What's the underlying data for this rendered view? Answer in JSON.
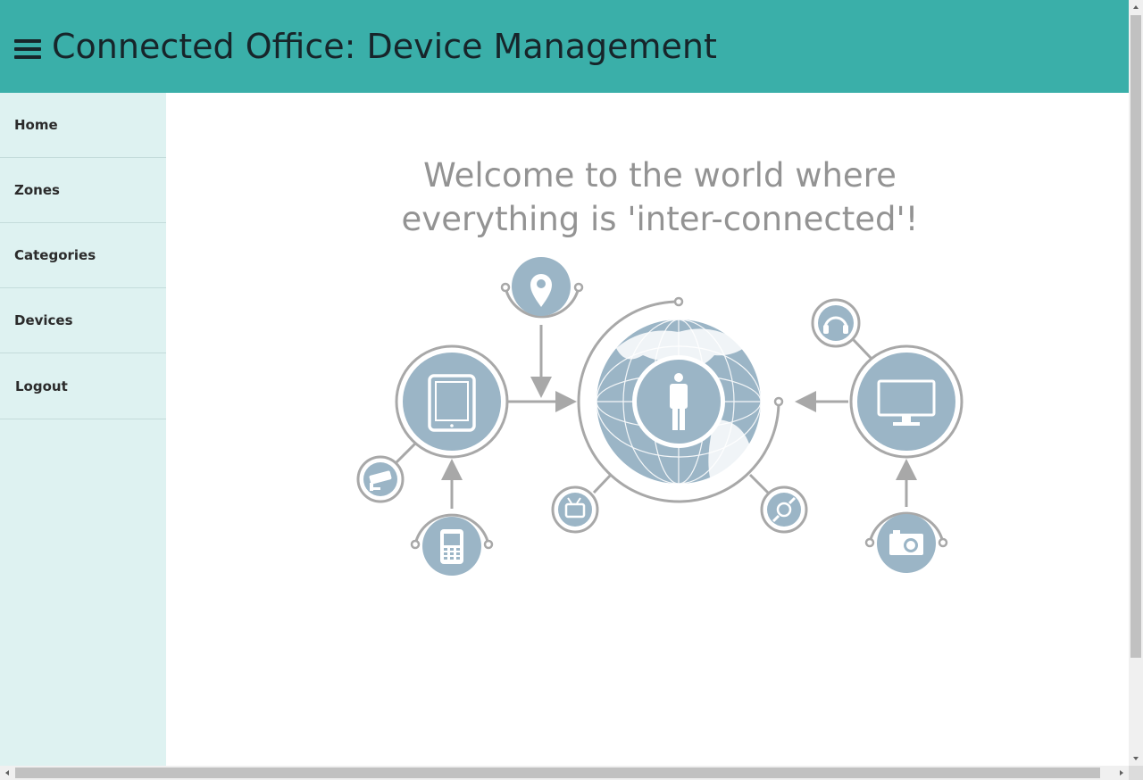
{
  "header": {
    "title": "Connected Office: Device Management"
  },
  "sidebar": {
    "items": [
      {
        "label": "Home"
      },
      {
        "label": "Zones"
      },
      {
        "label": "Categories"
      },
      {
        "label": "Devices"
      },
      {
        "label": "Logout"
      }
    ]
  },
  "main": {
    "welcome_line1": "Welcome to the world where",
    "welcome_line2": "everything is 'inter-connected'!"
  },
  "illustration": {
    "nodes": [
      "tablet-icon",
      "map-pin-icon",
      "globe-person-icon",
      "monitor-icon",
      "headphones-icon",
      "camera-icon",
      "cctv-camera-icon",
      "mobile-phone-icon",
      "tv-icon",
      "watch-icon"
    ]
  },
  "colors": {
    "header_bg": "#3aafa9",
    "header_text": "#17252a",
    "sidebar_bg": "#def2f1",
    "icon_fill": "#9bb5c6",
    "line_gray": "#a8a8a8",
    "welcome_text": "#939393"
  }
}
